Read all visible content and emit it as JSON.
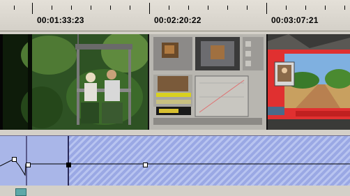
{
  "ruler": {
    "timecodes": [
      "00:01:33:23",
      "00:02:20:22",
      "00:03:07:21"
    ]
  },
  "filmstrip": {
    "frames": [
      "jungle-cable-car-frame",
      "software-ui-frame",
      "desert-road-pip-frame"
    ]
  },
  "track": {
    "keyframes": 4
  },
  "colors": {
    "track_fill": "#a9b6e8",
    "track_hatch": "#9aa8e4",
    "ruler_bg": "#d4d0c8",
    "pip_red": "#e03030",
    "handle": "#5fa8a8"
  }
}
